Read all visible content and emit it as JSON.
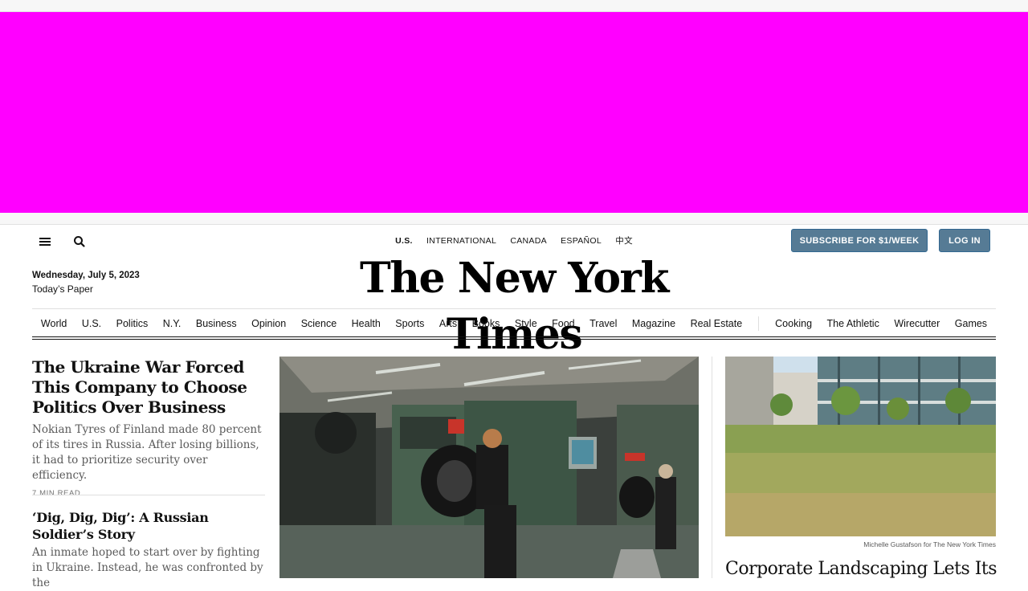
{
  "ad": {
    "color": "#ff00ff"
  },
  "header": {
    "menu_icon": "hamburger-menu-icon",
    "search_icon": "search-icon",
    "editions": [
      "U.S.",
      "INTERNATIONAL",
      "CANADA",
      "ESPAÑOL",
      "中文"
    ],
    "active_edition": "U.S.",
    "subscribe_label": "SUBSCRIBE FOR $1/WEEK",
    "login_label": "LOG IN",
    "date": "Wednesday, July 5, 2023",
    "todays_paper": "Today’s Paper",
    "logo_text": "The New York Times",
    "button_color": "#567b95"
  },
  "nav": {
    "sections": [
      "World",
      "U.S.",
      "Politics",
      "N.Y.",
      "Business",
      "Opinion",
      "Science",
      "Health",
      "Sports",
      "Arts",
      "Books",
      "Style",
      "Food",
      "Travel",
      "Magazine",
      "Real Estate"
    ],
    "products": [
      "Cooking",
      "The Athletic",
      "Wirecutter",
      "Games"
    ]
  },
  "stories": {
    "lead": {
      "headline": "The Ukraine War Forced This Company to Choose Politics Over Business",
      "summary": "Nokian Tyres of Finland made 80 percent of its tires in Russia. After losing billions, it had to prioritize security over efficiency.",
      "read_time": "7 MIN READ"
    },
    "second": {
      "headline": "‘Dig, Dig, Dig’: A Russian Soldier’s Story",
      "summary": "An inmate hoped to start over by fighting in Ukraine. Instead, he was confronted by the"
    },
    "right": {
      "credit": "Michelle Gustafson for The New York Times",
      "headline": "Corporate Landscaping Lets Its"
    }
  }
}
